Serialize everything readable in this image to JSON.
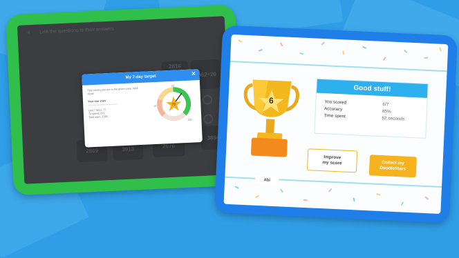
{
  "left_tablet": {
    "question_number": "4",
    "question_text": "Link the questions to their answers",
    "cards": [
      "7962÷20",
      "2816",
      "3913",
      "2676",
      "3894",
      "3680",
      "2809"
    ],
    "modal": {
      "title": "My 7-day target",
      "close_icon": "close-icon",
      "subtitle": "This means you are in the green zone. Well done!",
      "stats_title": "Your star stats",
      "stats": [
        {
          "label": "Last 7 days:",
          "value": "77"
        },
        {
          "label": "To spend:",
          "value": "372"
        },
        {
          "label": "Total stars:",
          "value": "2395"
        }
      ],
      "gauge": {
        "value": "75",
        "label_top": "50",
        "label_left": "25",
        "label_bottom_right": "100",
        "level": 0.75,
        "star_icon": "star-icon"
      }
    }
  },
  "right_tablet": {
    "trophy": {
      "number": "6",
      "name": "Abi",
      "star_icon": "star-icon"
    },
    "score_panel": {
      "title": "Good stuff!",
      "rows": [
        {
          "label": "You scored",
          "value": "6/7"
        },
        {
          "label": "Accuracy",
          "value": "85%"
        },
        {
          "label": "Time spent",
          "value": "62 seconds"
        }
      ]
    },
    "buttons": {
      "improve_line1": "Improve",
      "improve_line2": "my score",
      "collect_line1": "Collect my",
      "collect_line2": "DoodleStars"
    }
  },
  "colors": {
    "background": "#2f9ee6",
    "left_frame": "#2fbf4a",
    "right_frame": "#1f7ee8",
    "accent_yellow": "#f7b31f",
    "panel_header": "#2fb0ee"
  }
}
